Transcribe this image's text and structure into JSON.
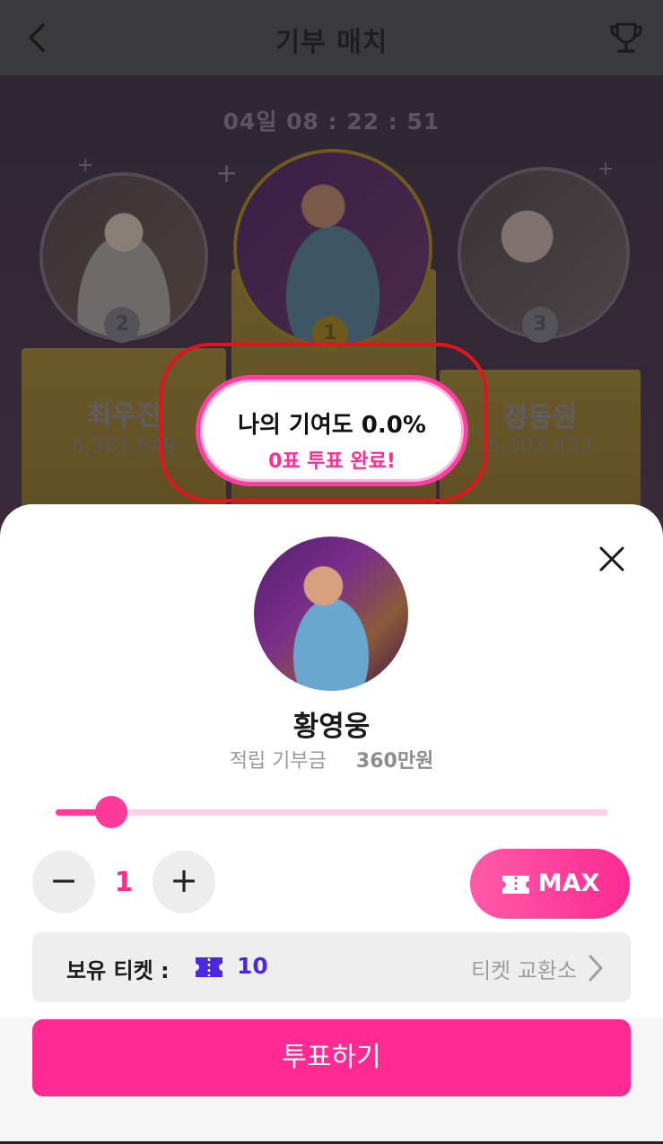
{
  "header": {
    "title": "기부 매치",
    "back_icon": "chevron-left-icon",
    "trophy_icon": "trophy-icon"
  },
  "match": {
    "timer": "04일 08 : 22 : 51",
    "ranks": [
      {
        "rank": "2",
        "name": "최우진",
        "votes": "6,561,649"
      },
      {
        "rank": "1",
        "name": "황영웅",
        "votes": ""
      },
      {
        "rank": "3",
        "name": "정동원",
        "votes": "5,103,433"
      }
    ]
  },
  "contribution": {
    "line1": "나의 기여도 0.0%",
    "line2": "0표 투표 완료!"
  },
  "sheet": {
    "artist_name": "황영웅",
    "donation_label": "적립 기부금",
    "donation_value": "360만원",
    "slider_fraction": 0.1,
    "minus_label": "−",
    "quantity": "1",
    "plus_label": "+",
    "max_label": "MAX",
    "tickets_label": "보유 티켓 :",
    "tickets_count": "10",
    "exchange_label": "티켓 교환소",
    "vote_button": "투표하기"
  },
  "colors": {
    "accent": "#ff2a92",
    "ticket": "#4a28e0",
    "highlight": "#e2141e"
  }
}
